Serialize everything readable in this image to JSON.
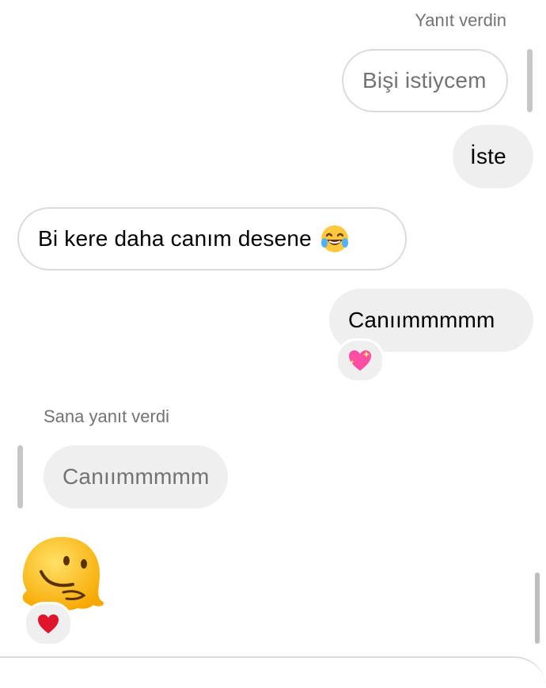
{
  "thread": {
    "outgoing_reply_caption": "Yanıt verdin",
    "outgoing_reply_quote": "Bişi istiycem",
    "message_iste": "İste",
    "incoming_message": "Bi kere daha canım desene",
    "incoming_emoji": "laughing-tears-emoji",
    "outgoing_message": "Canıımmmmm",
    "outgoing_reaction": "sparkling-heart-emoji",
    "incoming_reply_caption": "Sana yanıt verdi",
    "incoming_reply_quote": "Canıımmmmm",
    "melting_emoji": "melting-face-emoji",
    "melting_reaction": "red-heart-emoji"
  },
  "colors": {
    "bubble_gray": "#efefef",
    "outline_gray": "#dbdbdb",
    "caption_gray": "#737373",
    "emoji_yellow": "#ffc83d",
    "heart_red": "#e0142b",
    "sparkle_pink": "#ff4fa3"
  }
}
